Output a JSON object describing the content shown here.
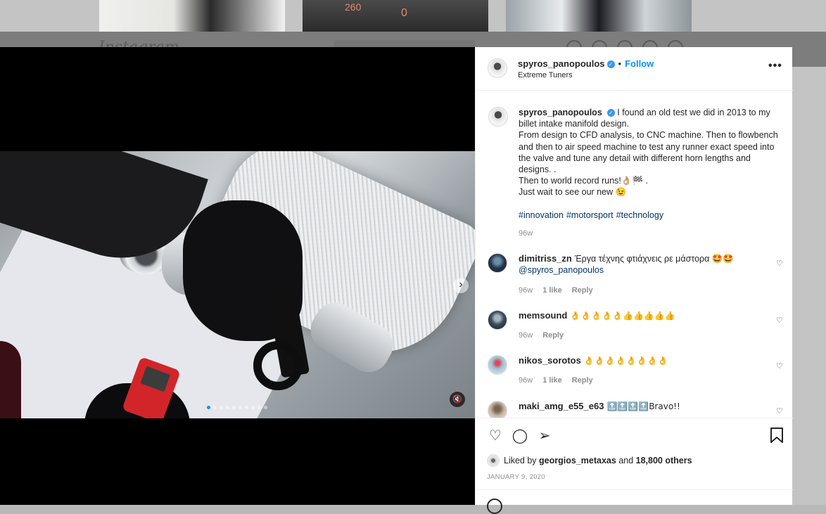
{
  "background": {
    "logo": "Instagram",
    "thumb2_text_left": "260",
    "thumb2_text_right": "0"
  },
  "post": {
    "author": {
      "username": "spyros_panopoulos",
      "verified": true,
      "follow_label": "Follow",
      "separator": "•",
      "location": "Extreme Tuners"
    },
    "more_icon": "more-dots-icon",
    "media": {
      "slide_count": 10,
      "active_slide": 1,
      "next_icon": "›",
      "mute_icon": "🔇"
    },
    "caption": {
      "username": "spyros_panopoulos",
      "lines": [
        "I found an old test we did in 2013 to my billet intake manifold design.",
        "From design to CFD analysis, to CNC machine. Then to flowbench and then to air speed machine to test any runner exact speed into the valve and tune any detail with different horn lengths and designs. .",
        "Then to world record runs!👌🏼🏁 .",
        "Just wait to see our new 😉"
      ],
      "hashtags": [
        "#innovation",
        "#motorsport",
        "#technology"
      ],
      "age": "96w"
    },
    "comments": [
      {
        "username": "dimitriss_zn",
        "text": "Έργα τέχνης φτιάχνεις ρε μάστορα 🤩🤩",
        "mention": "@spyros_panopoulos",
        "age": "96w",
        "likes": "1 like",
        "reply": "Reply"
      },
      {
        "username": "memsound",
        "text": "👌👌👌👌👌👍👍👍👍👍",
        "age": "96w",
        "likes": "",
        "reply": "Reply"
      },
      {
        "username": "nikos_sorotos",
        "text": "👌👌👌👌👌👌👌👌",
        "age": "96w",
        "likes": "1 like",
        "reply": "Reply"
      },
      {
        "username": "maki_amg_e55_e63",
        "text": "🔝🔝🔝🔝Bravo!!",
        "age": "",
        "likes": "",
        "reply": ""
      }
    ],
    "actions": {
      "like_icon": "♡",
      "comment_icon": "◯",
      "share_icon": "➢",
      "save_icon": "🔖"
    },
    "likes": {
      "prefix": "Liked by",
      "user": "georgios_metaxas",
      "joiner": "and",
      "others": "18,800 others"
    },
    "date": "JANUARY 9, 2020"
  }
}
